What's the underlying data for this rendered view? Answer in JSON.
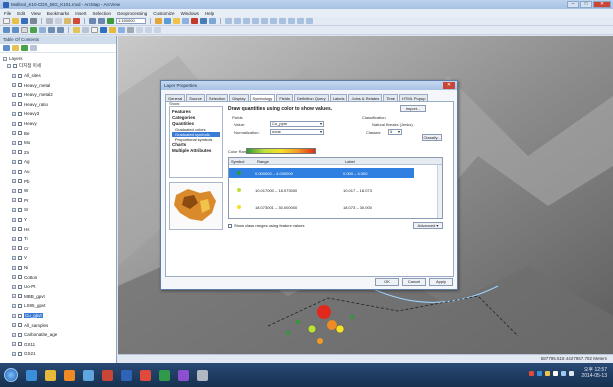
{
  "window": {
    "title": "Mollisol_K10-CDX_BIG_K101.mxd - ArcMap - ArcView",
    "minimize": "–",
    "maximize": "□",
    "close": "✕"
  },
  "menu": [
    "File",
    "Edit",
    "View",
    "Bookmarks",
    "Insert",
    "Selection",
    "Geoprocessing",
    "Customize",
    "Windows",
    "Help"
  ],
  "toolbar": {
    "scale": "1:150000"
  },
  "toc": {
    "title": "Table Of Contents",
    "root": "Layers",
    "group": "다지점 미세",
    "layers": [
      {
        "name": "All_sites",
        "checked": true
      },
      {
        "name": "Heavy_metal",
        "checked": true
      },
      {
        "name": "Heavy_metal2",
        "checked": true
      },
      {
        "name": "Heavy_ratio",
        "checked": true
      },
      {
        "name": "Heavy3",
        "checked": true
      },
      {
        "name": "Heavy",
        "checked": true
      },
      {
        "name": "Be",
        "checked": true
      },
      {
        "name": "Mo",
        "checked": true
      },
      {
        "name": "Zn",
        "checked": true
      },
      {
        "name": "Ag",
        "checked": true
      },
      {
        "name": "Au",
        "checked": true
      },
      {
        "name": "Pb",
        "checked": true
      },
      {
        "name": "W",
        "checked": true
      },
      {
        "name": "Pr",
        "checked": true
      },
      {
        "name": "Sr",
        "checked": true
      },
      {
        "name": "Y",
        "checked": true
      },
      {
        "name": "Hs",
        "checked": true
      },
      {
        "name": "Ti",
        "checked": true
      },
      {
        "name": "Cr",
        "checked": true
      },
      {
        "name": "V",
        "checked": true
      },
      {
        "name": "Ni",
        "checked": true
      },
      {
        "name": "Cotton",
        "checked": true
      },
      {
        "name": "Uo-Pt",
        "checked": true
      },
      {
        "name": "MBB_gpvt",
        "checked": true
      },
      {
        "name": "LS95_gpvt",
        "checked": true
      },
      {
        "name": "Cu_gpvt",
        "checked": true,
        "selected": true
      },
      {
        "name": "All_samples",
        "checked": true
      },
      {
        "name": "Carbonatite_age",
        "checked": true
      },
      {
        "name": "GS11",
        "checked": true
      },
      {
        "name": "GS21",
        "checked": true
      }
    ]
  },
  "dialog": {
    "title": "Layer Properties",
    "tabs": [
      "General",
      "Source",
      "Selection",
      "Display",
      "Symbology",
      "Fields",
      "Definition Query",
      "Labels",
      "Joins & Relates",
      "Time",
      "HTML Popup"
    ],
    "active_tab": "Symbology",
    "show_label": "Show:",
    "show_items": [
      {
        "label": "Features",
        "style": "bold"
      },
      {
        "label": "Categories",
        "style": "bold"
      },
      {
        "label": "Quantities",
        "style": "bold"
      },
      {
        "label": "Graduated colors",
        "style": "sub"
      },
      {
        "label": "Graduated symbols",
        "style": "sub",
        "selected": true
      },
      {
        "label": "Proportional symbols",
        "style": "sub"
      },
      {
        "label": "Charts",
        "style": "bold"
      },
      {
        "label": "Multiple Attributes",
        "style": "bold"
      }
    ],
    "heading": "Draw quantities using color to show values.",
    "import_label": "Import...",
    "fields_label": "Fields",
    "value_label": "Value:",
    "value": "Cu_ppm",
    "normalization_label": "Normalization:",
    "normalization": "none",
    "classification_label": "Classification",
    "classification_method": "Natural Breaks (Jenks)",
    "classes_label": "Classes:",
    "classes": "5",
    "classify_label": "Classify...",
    "color_ramp_label": "Color Ramp:",
    "table_headers": [
      "Symbol",
      "Range",
      "Label"
    ],
    "classes_list": [
      {
        "range": "0.000000 – 4.000000",
        "label": "0.000 – 4.000",
        "color": "#2e9a36",
        "selected": true
      },
      {
        "range": "10.017000 – 18.073000",
        "label": "10.017 – 18.073",
        "color": "#bce03a"
      },
      {
        "range": "18.073001 – 30.000000",
        "label": "18.073 – 30.000",
        "color": "#f6e02a"
      }
    ],
    "show_class_ranges": "Show class ranges using feature values",
    "advanced_label": "Advanced ▾",
    "ok": "OK",
    "cancel": "Cancel",
    "apply": "Apply"
  },
  "status": {
    "left": "",
    "coords": "587795.518 4427957.782 Meters"
  },
  "taskbar": {
    "time": "오후 12:57",
    "date": "2014-05-13"
  }
}
